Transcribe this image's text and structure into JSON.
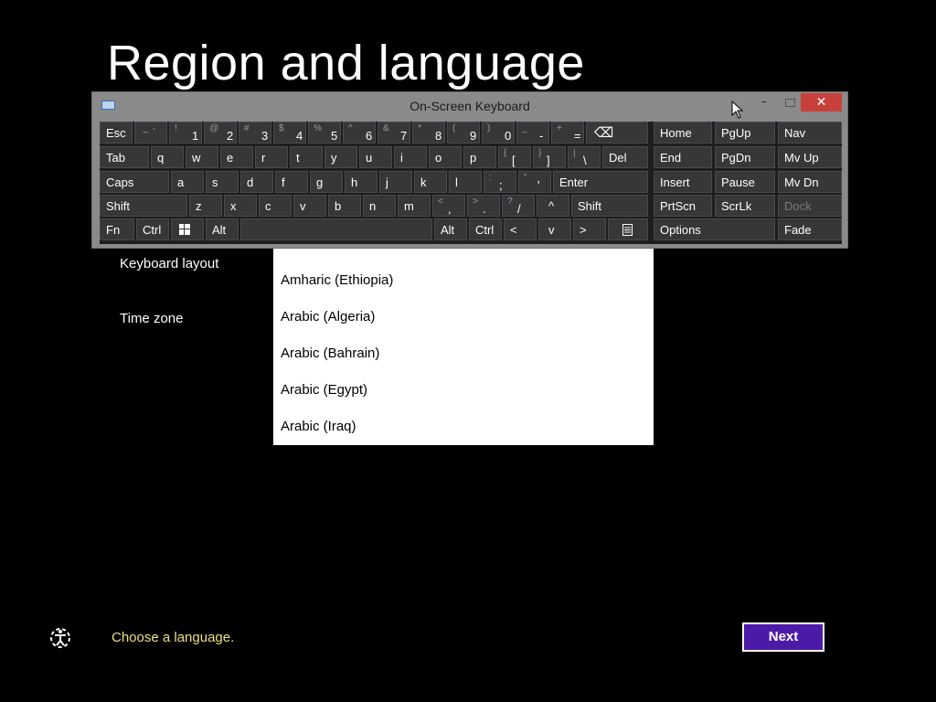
{
  "page": {
    "title": "Region and language",
    "keyboard_layout_label": "Keyboard layout",
    "time_zone_label": "Time zone",
    "status_text": "Choose a language.",
    "next_label": "Next",
    "accessibility_icon": "ease-of-access-icon"
  },
  "dropdown": {
    "partial_item": "Amharic (Ethiopia)",
    "items": [
      "Amharic (Ethiopia)",
      "Arabic (Algeria)",
      "Arabic (Bahrain)",
      "Arabic (Egypt)",
      "Arabic (Iraq)"
    ]
  },
  "osk": {
    "title": "On-Screen Keyboard",
    "min_glyph": "–",
    "close_glyph": "✕",
    "keys": {
      "esc": "Esc",
      "tilde_shift": "~ `",
      "n1s": "!",
      "n1": "1",
      "n2s": "@",
      "n2": "2",
      "n3s": "#",
      "n3": "3",
      "n4s": "$",
      "n4": "4",
      "n5s": "%",
      "n5": "5",
      "n6s": "^",
      "n6": "6",
      "n7s": "&",
      "n7": "7",
      "n8s": "*",
      "n8": "8",
      "n9s": "(",
      "n9": "9",
      "n0s": ")",
      "n0": "0",
      "minus_s": "_",
      "minus": "-",
      "plus_s": "+",
      "equals": "=",
      "backspace": "⌫",
      "tab": "Tab",
      "q": "q",
      "w": "w",
      "e": "e",
      "r": "r",
      "t": "t",
      "y": "y",
      "u": "u",
      "i": "i",
      "o": "o",
      "p": "p",
      "lbrace_s": "{",
      "lbrace": "[",
      "rbrace_s": "}",
      "rbrace": "]",
      "pipe_s": "|",
      "backslash": "\\",
      "del": "Del",
      "caps": "Caps",
      "a": "a",
      "s": "s",
      "d": "d",
      "f": "f",
      "g": "g",
      "h": "h",
      "j": "j",
      "k": "k",
      "l": "l",
      "colon_s": ":",
      "semicolon": ";",
      "quote_s": "\"",
      "quote": "'",
      "enter": "Enter",
      "shift": "Shift",
      "z": "z",
      "x": "x",
      "c": "c",
      "v": "v",
      "b": "b",
      "n": "n",
      "m": "m",
      "lt_s": "<",
      "comma": ",",
      "gt_s": ">",
      "period": ".",
      "q_s": "?",
      "slash": "/",
      "up": "^",
      "shift_r": "Shift",
      "fn": "Fn",
      "ctrl": "Ctrl",
      "alt": "Alt",
      "alt_r": "Alt",
      "ctrl_r": "Ctrl",
      "left": "<",
      "down": "v",
      "right": ">",
      "home": "Home",
      "pgup": "PgUp",
      "nav": "Nav",
      "end": "End",
      "pgdn": "PgDn",
      "mvup": "Mv Up",
      "insert": "Insert",
      "pause": "Pause",
      "mvdn": "Mv Dn",
      "prtscn": "PrtScn",
      "scrlk": "ScrLk",
      "dock": "Dock",
      "options": "Options",
      "fade": "Fade"
    }
  },
  "colors": {
    "background": "#000000",
    "next_button": "#4b1ba8",
    "status_text": "#e8e07a",
    "close_button": "#c7413a"
  }
}
